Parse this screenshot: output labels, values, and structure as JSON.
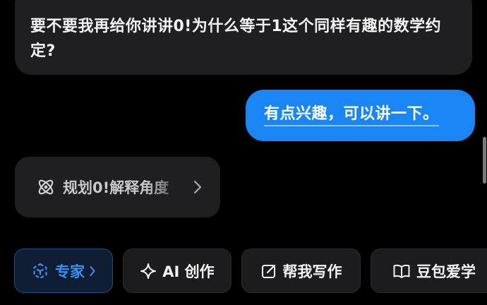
{
  "conversation": {
    "bot_message": "要不要我再给你讲讲0!为什么等于1这个同样有趣的数学约定?",
    "user_message": "有点兴趣，可以讲一下。"
  },
  "plan_card": {
    "label": "规划0!解释角度",
    "icon": "atom-icon"
  },
  "quick_actions": [
    {
      "label": "专家",
      "icon": "expert-cube-icon",
      "active": true
    },
    {
      "label": "AI 创作",
      "icon": "sparkle-icon"
    },
    {
      "label": "帮我写作",
      "icon": "edit-icon"
    },
    {
      "label": "豆包爱学",
      "icon": "book-icon"
    }
  ],
  "colors": {
    "background": "#000000",
    "bubble_dark": "#1f1f21",
    "user_bubble": "#1a86f5",
    "expert_accent": "#3b8ff0"
  }
}
